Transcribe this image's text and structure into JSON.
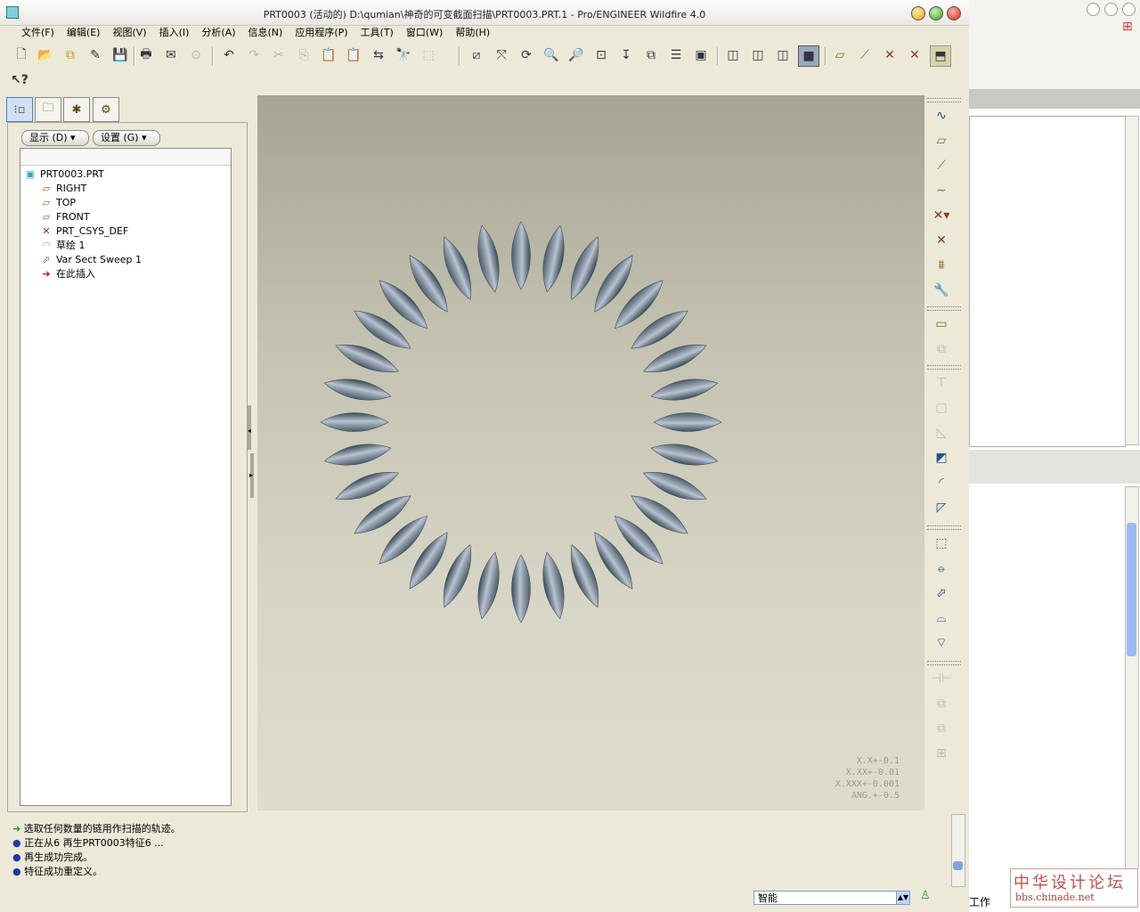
{
  "window": {
    "title": "PRT0003 (活动的) D:\\qumian\\神奇的可变截面扫描\\PRT0003.PRT.1 - Pro/ENGINEER Wildfire 4.0"
  },
  "menu": [
    "文件(F)",
    "编辑(E)",
    "视图(V)",
    "插入(I)",
    "分析(A)",
    "信息(N)",
    "应用程序(P)",
    "工具(T)",
    "窗口(W)",
    "帮助(H)"
  ],
  "tree": {
    "show_button": "显示 (D)",
    "settings_button": "设置 (G)",
    "items": [
      {
        "label": "PRT0003.PRT",
        "icon": "part-icon"
      },
      {
        "label": "RIGHT",
        "icon": "datum-plane-icon"
      },
      {
        "label": "TOP",
        "icon": "datum-plane-icon"
      },
      {
        "label": "FRONT",
        "icon": "datum-plane-icon"
      },
      {
        "label": "PRT_CSYS_DEF",
        "icon": "csys-icon"
      },
      {
        "label": "草绘 1",
        "icon": "sketch-icon"
      },
      {
        "label": "Var Sect Sweep 1",
        "icon": "sweep-icon"
      },
      {
        "label": "在此插入",
        "icon": "insert-arrow-icon"
      }
    ]
  },
  "graphics": {
    "tolerances": [
      "X.X+-0.1",
      "X.XX+-0.01",
      "X.XXX+-0.001",
      "ANG.+-0.5"
    ],
    "colors": {
      "blade": "#6f7e8c",
      "background": "#d0cebf"
    }
  },
  "messages": [
    "选取任何数量的链用作扫描的轨迹。",
    "正在从6 再生PRT0003特征6 ...",
    "再生成功完成。",
    "特征成功重定义。"
  ],
  "status": {
    "selection_filter": "智能"
  },
  "other_window": {
    "label": "工作"
  },
  "watermark": {
    "line1": "中华设计论坛",
    "line2": "bbs.chinade.net"
  }
}
